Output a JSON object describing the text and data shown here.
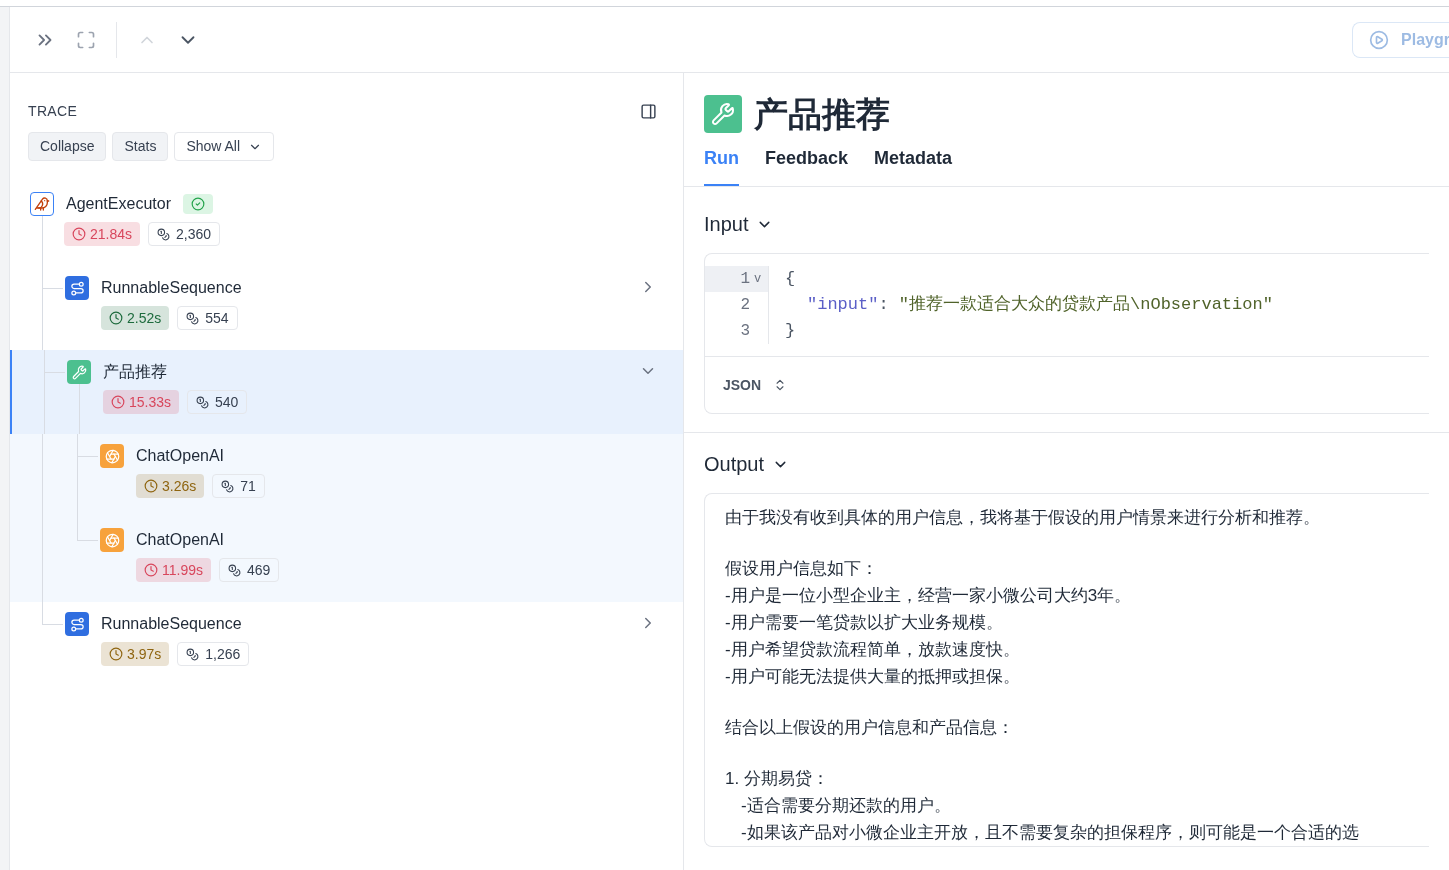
{
  "toolbar": {
    "playground_button": "Playgr"
  },
  "trace": {
    "title": "TRACE",
    "buttons": [
      {
        "label": "Collapse"
      },
      {
        "label": "Stats"
      }
    ],
    "filter": "Show All",
    "nodes": [
      {
        "name": "AgentExecutor",
        "kind": "agent",
        "status_ok": true,
        "latency": "21.84s",
        "color": "#d8465c",
        "tokens": "2,360",
        "selected": false,
        "children": [
          {
            "name": "RunnableSequence",
            "kind": "chain",
            "latency": "2.52s",
            "color": "#1d6b3d",
            "tokens": "554",
            "expanded": false,
            "selected": false
          },
          {
            "name": "产品推荐",
            "kind": "tool",
            "latency": "15.33s",
            "color": "#d8465c",
            "tokens": "540",
            "expanded": true,
            "selected": true,
            "children": [
              {
                "name": "ChatOpenAI",
                "kind": "llm",
                "latency": "3.26s",
                "color": "#8f6510",
                "tokens": "71",
                "selected": false
              },
              {
                "name": "ChatOpenAI",
                "kind": "llm",
                "latency": "11.99s",
                "color": "#d8465c",
                "tokens": "469",
                "selected": false
              }
            ]
          },
          {
            "name": "RunnableSequence",
            "kind": "chain",
            "latency": "3.97s",
            "color": "#8f6510",
            "tokens": "1,266",
            "expanded": false,
            "selected": false
          }
        ]
      }
    ]
  },
  "run": {
    "title": "产品推荐",
    "tabs": [
      {
        "label": "Run",
        "selected": true
      },
      {
        "label": "Feedback",
        "selected": false
      },
      {
        "label": "Metadata",
        "selected": false
      }
    ],
    "input": {
      "heading": "Input",
      "format": "JSON",
      "lines": [
        {
          "number": "1",
          "fold": "v",
          "active": true,
          "tokens": [
            {
              "kind": "punct",
              "text": "{"
            }
          ]
        },
        {
          "number": "2",
          "active": false,
          "tokens": [
            {
              "kind": "key",
              "text": "\"input\""
            },
            {
              "kind": "punct",
              "text": ":"
            },
            {
              "kind": "string",
              "text": "\"推荐一款适合大众的贷款产品\\nObservation\""
            }
          ]
        },
        {
          "number": "3",
          "active": false,
          "tokens": [
            {
              "kind": "punct",
              "text": "}"
            }
          ]
        }
      ]
    },
    "output": {
      "heading": "Output",
      "blocks": [
        {
          "lines": [
            {
              "text": "由于我没有收到具体的用户信息，我将基于假设的用户情景来进行分析和推荐。",
              "indent": false
            }
          ]
        },
        {
          "lines": [
            {
              "text": "假设用户信息如下：",
              "indent": false
            },
            {
              "text": "-用户是一位小型企业主，经营一家小微公司大约3年。",
              "indent": false
            },
            {
              "text": "-用户需要一笔贷款以扩大业务规模。",
              "indent": false
            },
            {
              "text": "-用户希望贷款流程简单，放款速度快。",
              "indent": false
            },
            {
              "text": "-用户可能无法提供大量的抵押或担保。",
              "indent": false
            }
          ]
        },
        {
          "lines": [
            {
              "text": "结合以上假设的用户信息和产品信息：",
              "indent": false
            }
          ]
        },
        {
          "lines": [
            {
              "text": "1. 分期易贷：",
              "indent": false
            },
            {
              "text": "-适合需要分期还款的用户。",
              "indent": true
            },
            {
              "text": "-如果该产品对小微企业主开放，且不需要复杂的担保程序，则可能是一个合适的选",
              "indent": true
            }
          ]
        }
      ]
    }
  }
}
